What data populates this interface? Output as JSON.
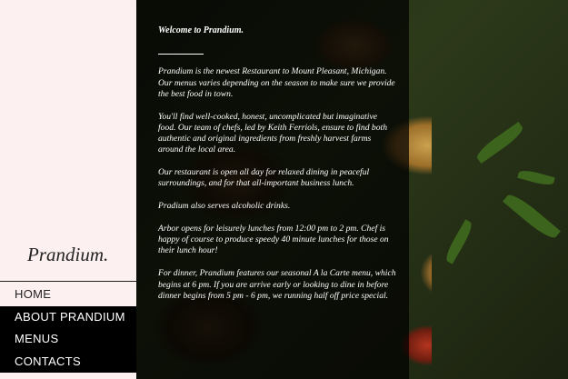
{
  "brand": "Prandium.",
  "nav": [
    {
      "label": "HOME",
      "active": true
    },
    {
      "label": "ABOUT PRANDIUM",
      "active": false
    },
    {
      "label": "MENUS",
      "active": false
    },
    {
      "label": "CONTACTS",
      "active": false
    }
  ],
  "content": {
    "heading": "Welcome to Prandium.",
    "paragraphs": [
      "Prandium is the newest Restaurant to Mount Pleasant, Michigan. Our menus varies depending on the season to make sure we provide the best food in town.",
      "You'll find well-cooked, honest, uncomplicated but imaginative food. Our team of chefs, led by Keith Ferriols, ensure to find both authentic and original ingredients from freshly harvest farms around the local area.",
      "Our restaurant is open all day for relaxed dining in peaceful surroundings, and for that all-important business lunch.",
      "Pradium also serves alcoholic drinks.",
      "Arbor opens for leisurely lunches from 12:00 pm to 2 pm. Chef is happy of course to produce speedy 40 minute lunches for those on their lunch hour!",
      "For dinner, Prandium features our seasonal A la Carte menu, which begins at 6 pm. If you are arrive early or looking to dine in before dinner begins from 5 pm - 6 pm, we running half off price special."
    ]
  },
  "colors": {
    "sidebar_bg": "#fdf0f0",
    "nav_bg": "#000000",
    "text_light": "#ffffff",
    "text_dark": "#222222"
  }
}
